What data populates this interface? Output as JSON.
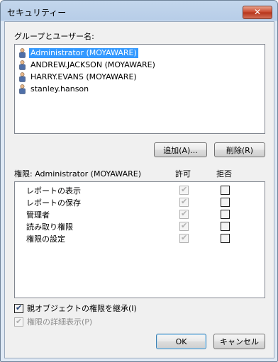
{
  "window": {
    "title": "セキュリティー",
    "close_label": "✕"
  },
  "users_section": {
    "label": "グループとユーザー名:",
    "users": [
      {
        "name": "Administrator (MOYAWARE)",
        "selected": true
      },
      {
        "name": "ANDREW.JACKSON (MOYAWARE)",
        "selected": false
      },
      {
        "name": "HARRY.EVANS (MOYAWARE)",
        "selected": false
      },
      {
        "name": "stanley.hanson",
        "selected": false
      }
    ],
    "add_button": "追加(A)...",
    "remove_button": "削除(R)"
  },
  "permissions": {
    "header": "権限: Administrator (MOYAWARE)",
    "allow_header": "許可",
    "deny_header": "拒否",
    "rows": [
      {
        "label": "レポートの表示",
        "allow": true,
        "deny": false
      },
      {
        "label": "レポートの保存",
        "allow": true,
        "deny": false
      },
      {
        "label": "管理者",
        "allow": true,
        "deny": false
      },
      {
        "label": "読み取り権限",
        "allow": true,
        "deny": false
      },
      {
        "label": "権限の設定",
        "allow": true,
        "deny": false
      }
    ]
  },
  "options": {
    "inherit_label": "親オブジェクトの権限を継承(I)",
    "inherit_checked": true,
    "advanced_label": "権限の詳細表示(P)",
    "advanced_checked": true
  },
  "footer": {
    "ok_label": "OK",
    "cancel_label": "キャンセル"
  },
  "colors": {
    "selection": "#3399ff",
    "dialog_bg": "#f0f0f0",
    "titlebar": "#b7cde8"
  }
}
